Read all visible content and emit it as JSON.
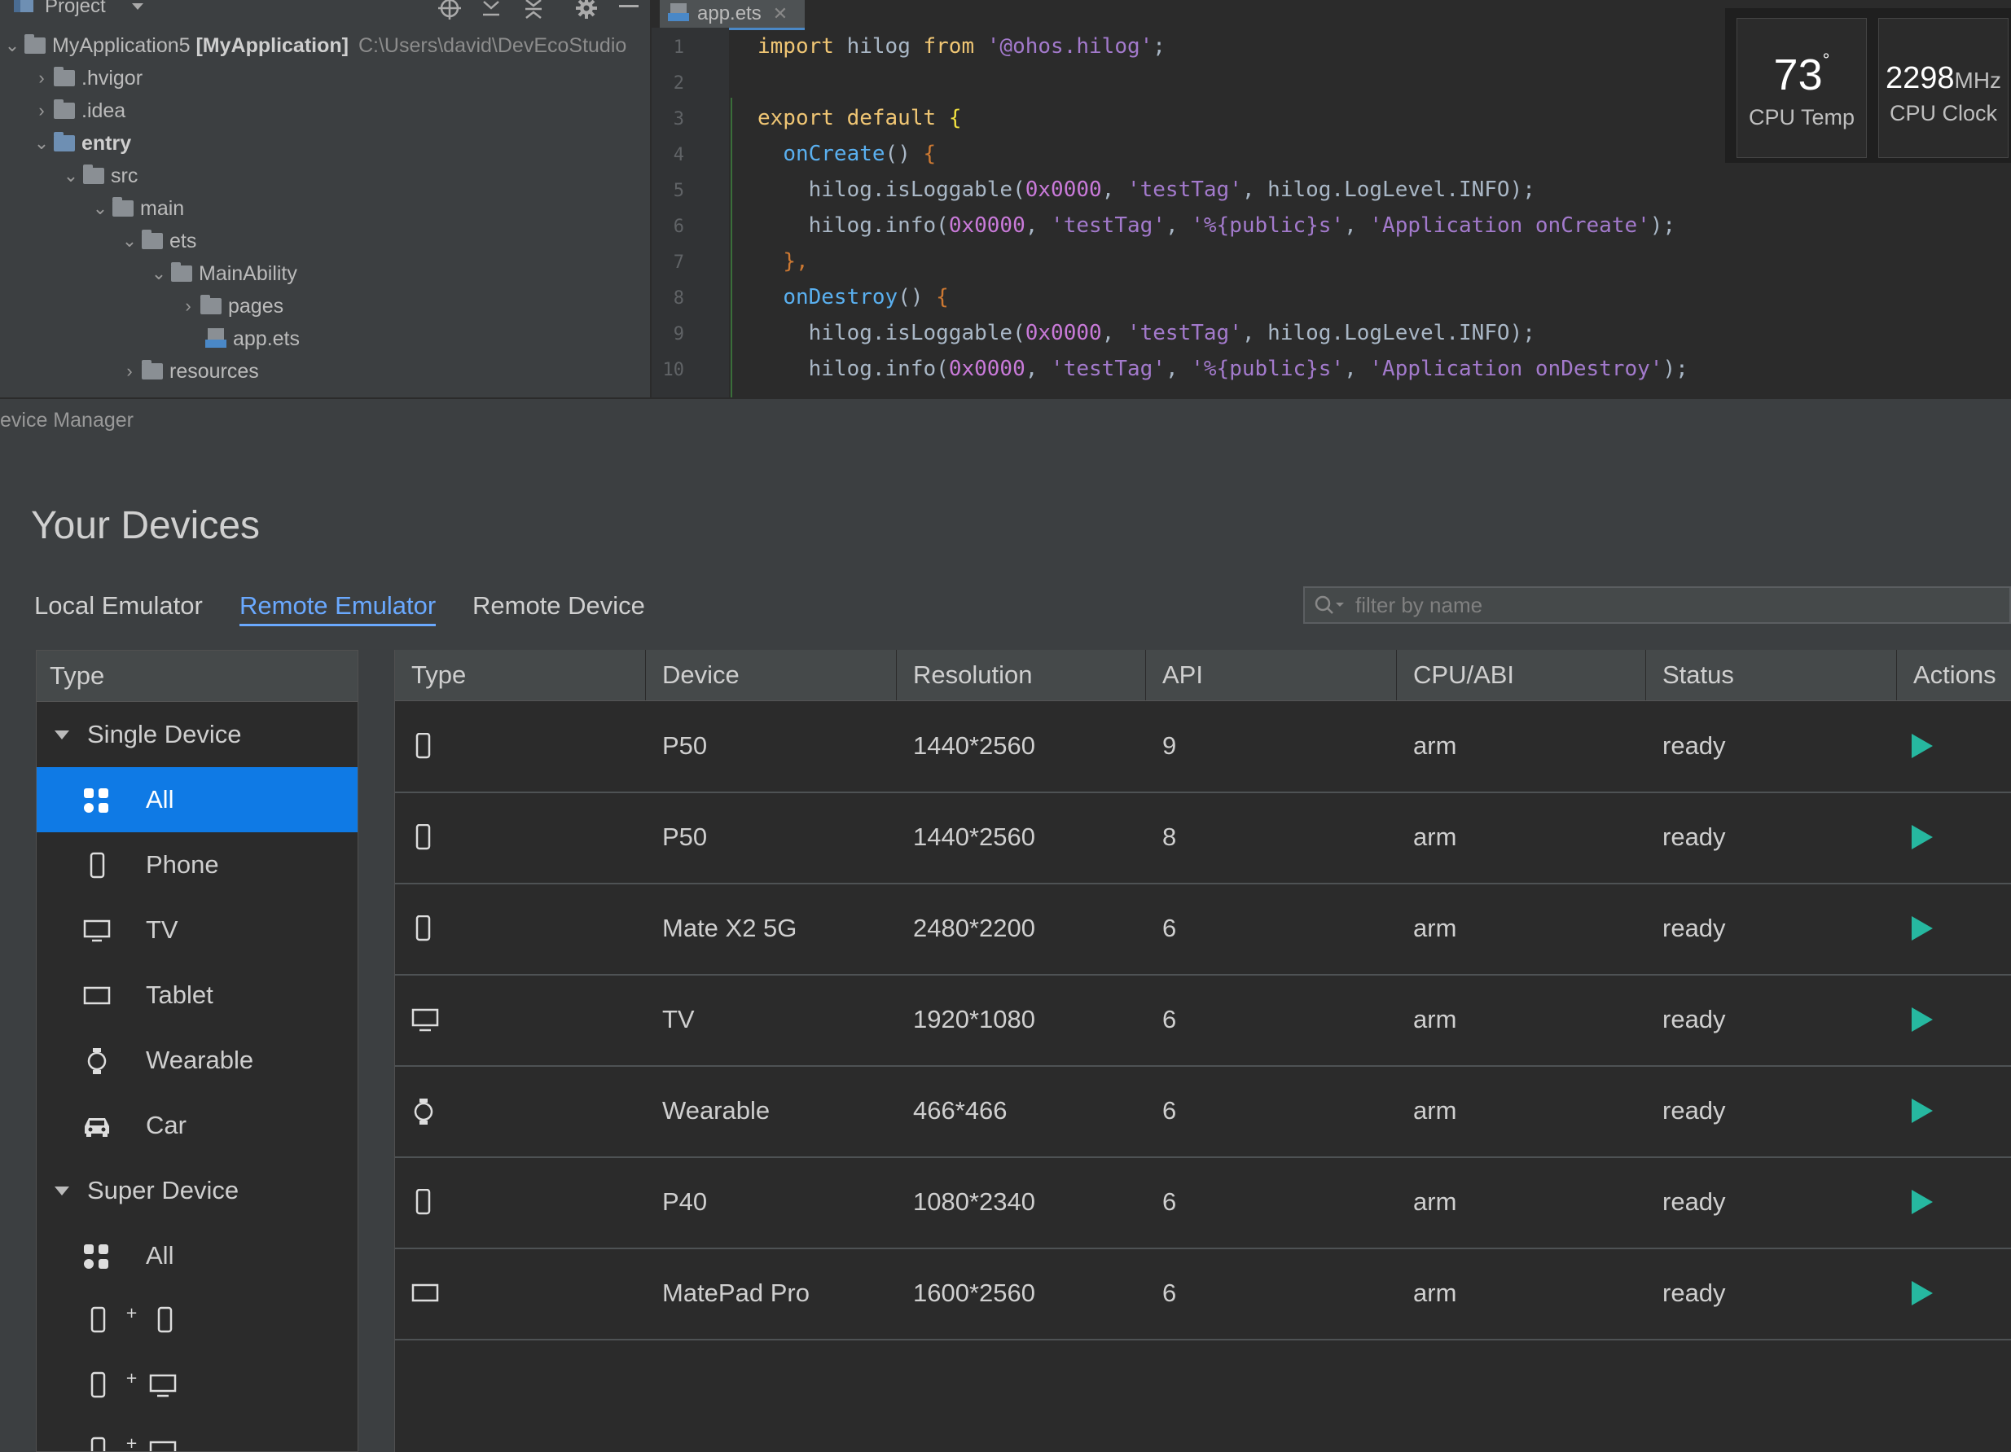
{
  "project_panel": {
    "title": "Project",
    "root_name": "MyApplication5",
    "root_module": "[MyApplication]",
    "root_path": "C:\\Users\\david\\DevEcoStudio",
    "items": [
      ".hvigor",
      ".idea",
      "entry",
      "src",
      "main",
      "ets",
      "MainAbility",
      "pages",
      "app.ets",
      "resources"
    ]
  },
  "editor": {
    "tab_label": "app.ets",
    "line_numbers": [
      "1",
      "2",
      "3",
      "4",
      "5",
      "6",
      "7",
      "8",
      "9",
      "10"
    ]
  },
  "cpu_widget": {
    "temp_value": "73",
    "temp_unit": "°",
    "temp_label": "CPU Temp",
    "clock_value": "2298",
    "clock_unit": "MHz",
    "clock_label": "CPU Clock"
  },
  "device_manager": {
    "panel_title": "evice Manager",
    "heading": "Your Devices",
    "tabs": [
      "Local Emulator",
      "Remote Emulator",
      "Remote Device"
    ],
    "active_tab": "Remote Emulator",
    "filter_placeholder": "filter by name",
    "type_panel": {
      "header": "Type",
      "group_single": "Single Device",
      "single_items": [
        "All",
        "Phone",
        "TV",
        "Tablet",
        "Wearable",
        "Car"
      ],
      "group_super": "Super Device",
      "super_items": [
        "All"
      ],
      "selected": "All"
    },
    "table": {
      "headers": [
        "Type",
        "Device",
        "Resolution",
        "API",
        "CPU/ABI",
        "Status",
        "Actions"
      ],
      "rows": [
        {
          "type_icon": "phone-icon",
          "device": "P50",
          "resolution": "1440*2560",
          "api": "9",
          "cpu": "arm",
          "status": "ready"
        },
        {
          "type_icon": "phone-icon",
          "device": "P50",
          "resolution": "1440*2560",
          "api": "8",
          "cpu": "arm",
          "status": "ready"
        },
        {
          "type_icon": "phone-icon",
          "device": "Mate X2 5G",
          "resolution": "2480*2200",
          "api": "6",
          "cpu": "arm",
          "status": "ready"
        },
        {
          "type_icon": "tv-icon",
          "device": "TV",
          "resolution": "1920*1080",
          "api": "6",
          "cpu": "arm",
          "status": "ready"
        },
        {
          "type_icon": "watch-icon",
          "device": "Wearable",
          "resolution": "466*466",
          "api": "6",
          "cpu": "arm",
          "status": "ready"
        },
        {
          "type_icon": "phone-icon",
          "device": "P40",
          "resolution": "1080*2340",
          "api": "6",
          "cpu": "arm",
          "status": "ready"
        },
        {
          "type_icon": "tablet-icon",
          "device": "MatePad Pro",
          "resolution": "1600*2560",
          "api": "6",
          "cpu": "arm",
          "status": "ready"
        }
      ]
    }
  },
  "colors": {
    "accent": "#0f7ae5",
    "play": "#26b8a0",
    "tab_active": "#6aa9ff"
  }
}
